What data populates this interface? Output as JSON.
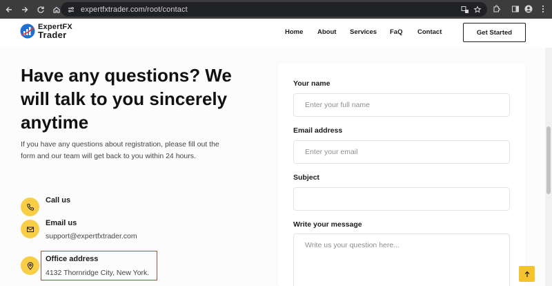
{
  "browser": {
    "url": "expertfxtrader.com/root/contact",
    "icons": [
      "back-arrow-icon",
      "forward-arrow-icon",
      "reload-icon",
      "home-icon",
      "site-settings-icon",
      "translate-icon",
      "bookmark-star-icon",
      "extensions-icon",
      "side-panel-icon",
      "profile-icon",
      "menu-kebab-icon"
    ]
  },
  "header": {
    "logo_line1": "ExpertFX",
    "logo_line2": "Trader",
    "nav": [
      "Home",
      "About",
      "Services",
      "FaQ",
      "Contact"
    ],
    "cta_label": "Get Started"
  },
  "intro": {
    "headline": "Have any questions? We will talk to you sincerely anytime",
    "text": "If you have any questions about registration, please fill out the form and our team will get back to you within 24 hours."
  },
  "contacts": [
    {
      "icon": "phone-icon",
      "title": "Call us",
      "value": ""
    },
    {
      "icon": "mail-icon",
      "title": "Email us",
      "value": "support@expertfxtrader.com"
    },
    {
      "icon": "location-pin-icon",
      "title": "Office address",
      "value": "4132 Thornridge City, New York."
    }
  ],
  "form": {
    "name_label": "Your name",
    "name_placeholder": "Enter your full name",
    "email_label": "Email address",
    "email_placeholder": "Enter your email",
    "subject_label": "Subject",
    "subject_placeholder": "",
    "message_label": "Write your message",
    "message_placeholder": "Write us your question here..."
  },
  "colors": {
    "accent_yellow": "#f7ce46",
    "highlight_border": "#a0522d",
    "chrome_bg": "#3c3c3c"
  }
}
